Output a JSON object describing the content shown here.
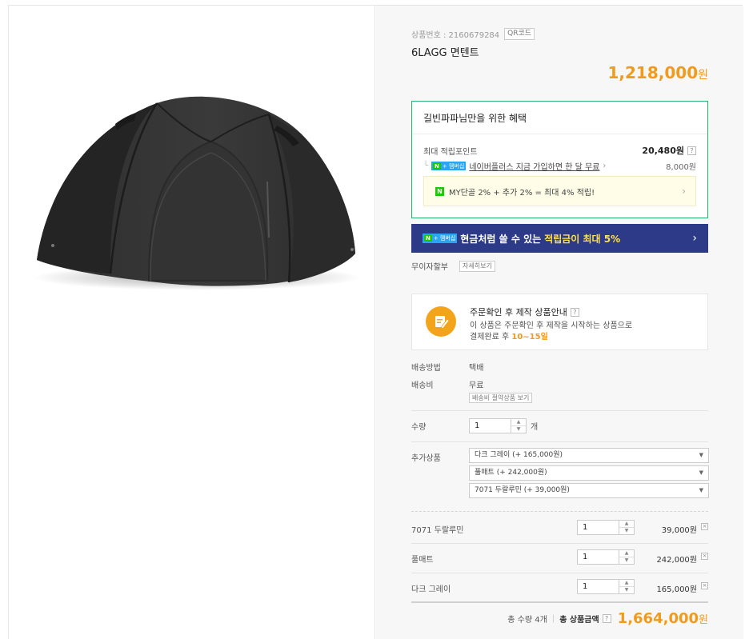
{
  "product": {
    "number_label": "상품번호 : 2160679284",
    "qr_label": "QR코드",
    "name": "6LAGG 면텐트",
    "price": "1,218,000",
    "won": "원"
  },
  "benefit": {
    "title": "길빈파파님만을 위한 혜택",
    "points_label": "최대 적립포인트",
    "points_value": "20,480원",
    "help_icon": "?",
    "naverplus_text": "네이버플러스 지금 가입하면 한 달 무료",
    "naverplus_value": "8,000원",
    "badge_n": "N",
    "badge_plus": "+",
    "badge_text": "멤버십",
    "my_text": "MY단골 2% + 추가 2% = 최대 4% 적립!"
  },
  "banner": {
    "text": "현금처럼 쓸 수 있는",
    "highlight": "적립금이 최대 5%"
  },
  "installment": {
    "label": "무이자할부",
    "button": "자세히보기"
  },
  "made_to_order": {
    "title": "주문확인 후 제작 상품안내",
    "line1": "이 상품은 주문확인 후 제작을 시작하는 상품으로",
    "line2_prefix": "결제완료 후",
    "line2_days": "10~15일"
  },
  "shipping": {
    "method_label": "배송방법",
    "method_value": "택배",
    "fee_label": "배송비",
    "fee_value": "무료",
    "fee_button": "배송비 절약상품 보기"
  },
  "quantity": {
    "label": "수량",
    "value": "1",
    "unit": "개"
  },
  "addons": {
    "label": "추가상품",
    "selects": [
      "다크 그레이 (+ 165,000원)",
      "풀매트 (+ 242,000원)",
      "7071 두랄루민 (+ 39,000원)"
    ]
  },
  "selected_items": [
    {
      "name": "7071 두랄루민",
      "qty": "1",
      "price": "39,000원"
    },
    {
      "name": "풀매트",
      "qty": "1",
      "price": "242,000원"
    },
    {
      "name": "다크 그레이",
      "qty": "1",
      "price": "165,000원"
    }
  ],
  "total": {
    "qty_text": "총 수량 4개",
    "label": "총 상품금액",
    "price": "1,664,000",
    "won": "원"
  },
  "colors": {
    "accent_orange": "#f29a1b",
    "benefit_border": "#28b46c",
    "banner_bg": "#2d3a87",
    "banner_highlight": "#ffe14d"
  }
}
